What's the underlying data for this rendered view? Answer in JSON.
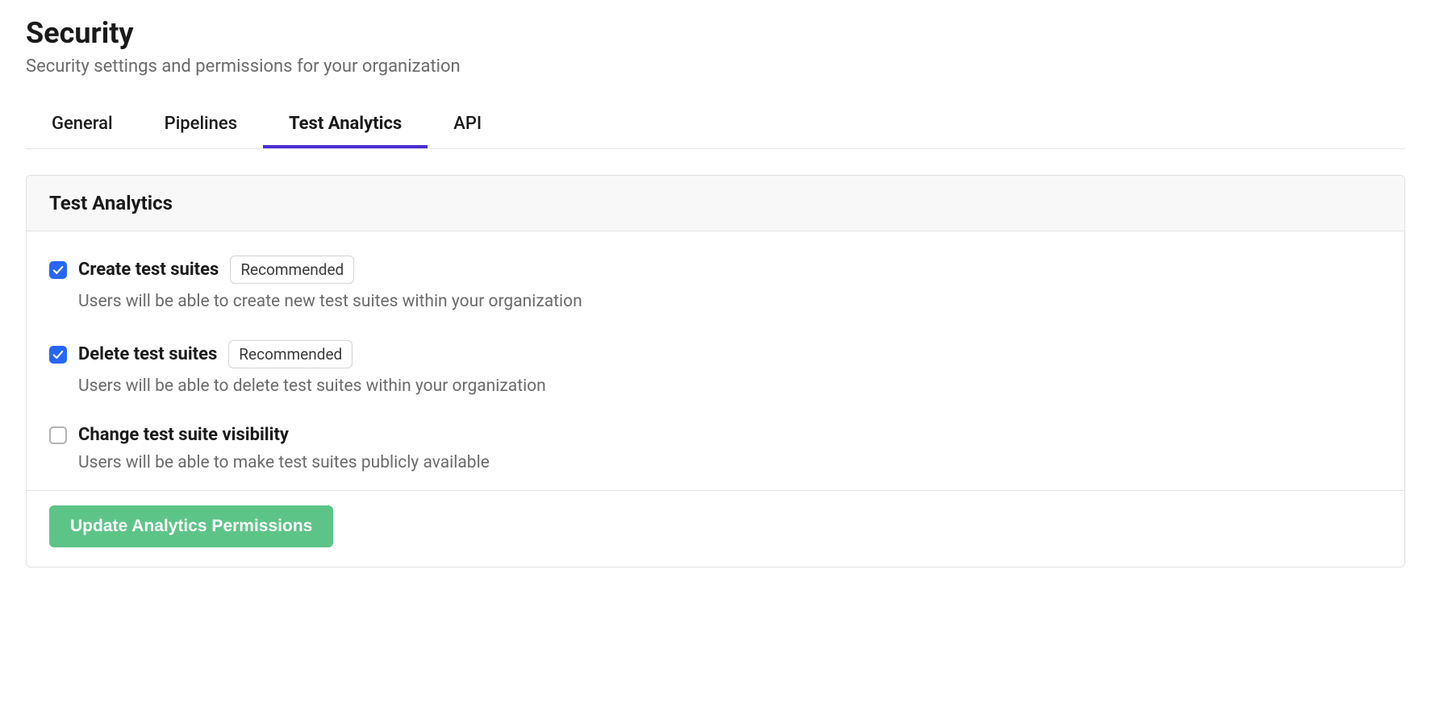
{
  "header": {
    "title": "Security",
    "subtitle": "Security settings and permissions for your organization"
  },
  "tabs": [
    {
      "label": "General",
      "active": false
    },
    {
      "label": "Pipelines",
      "active": false
    },
    {
      "label": "Test Analytics",
      "active": true
    },
    {
      "label": "API",
      "active": false
    }
  ],
  "panel": {
    "title": "Test Analytics",
    "options": [
      {
        "label": "Create test suites",
        "badge": "Recommended",
        "description": "Users will be able to create new test suites within your organization",
        "checked": true
      },
      {
        "label": "Delete test suites",
        "badge": "Recommended",
        "description": "Users will be able to delete test suites within your organization",
        "checked": true
      },
      {
        "label": "Change test suite visibility",
        "badge": null,
        "description": "Users will be able to make test suites publicly available",
        "checked": false
      }
    ],
    "submit_label": "Update Analytics Permissions"
  }
}
